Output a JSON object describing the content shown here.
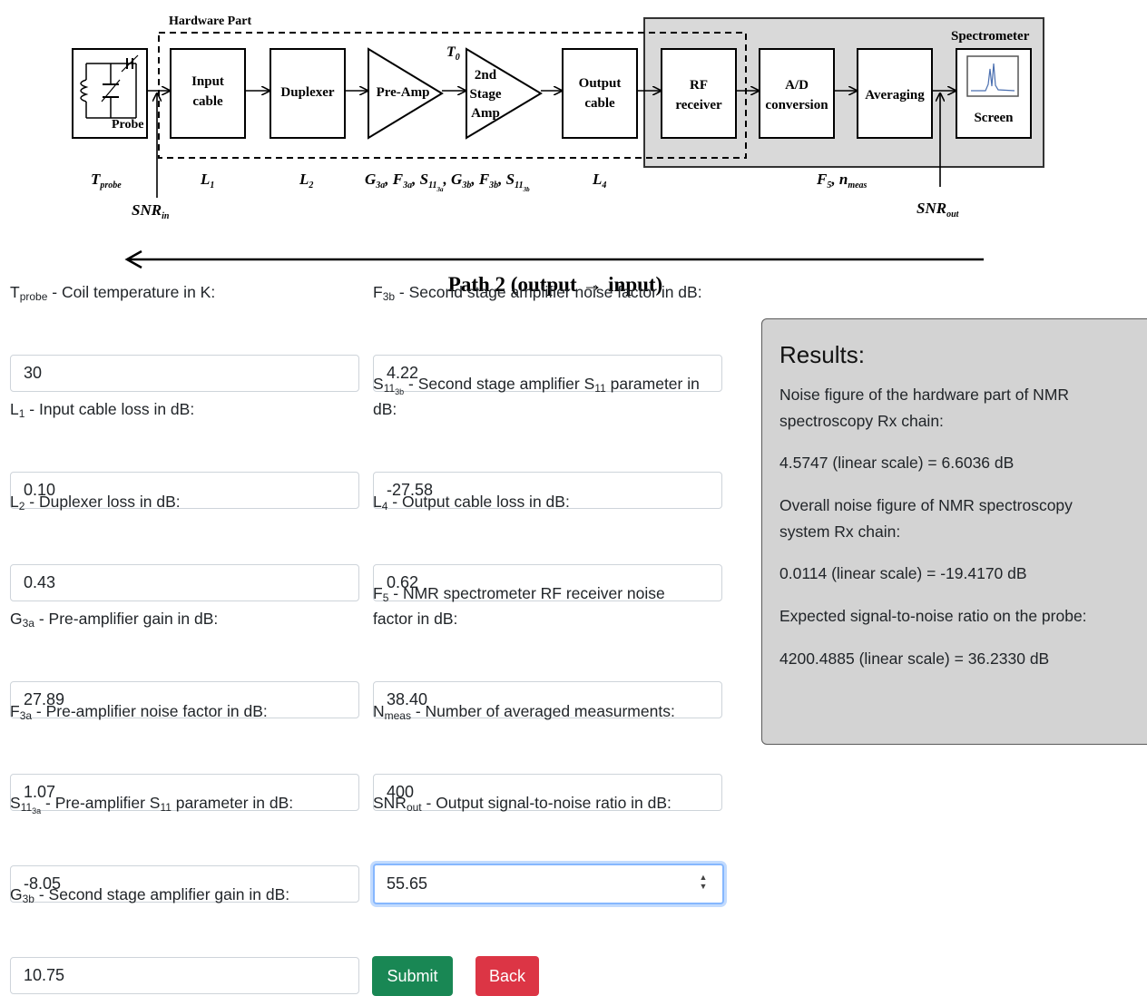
{
  "diagram": {
    "hardware_part": "Hardware Part",
    "spectrometer": "Spectrometer",
    "probe": "Probe",
    "blocks": {
      "input_cable": [
        "Input",
        "cable"
      ],
      "duplexer": "Duplexer",
      "pre_amp": "Pre-Amp",
      "stage2_amp": [
        "2nd",
        "Stage",
        "Amp"
      ],
      "output_cable": [
        "Output",
        "cable"
      ],
      "rf_receiver": [
        "RF",
        "receiver"
      ],
      "ad_conversion": [
        "A/D",
        "conversion"
      ],
      "averaging": "Averaging",
      "screen": "Screen"
    },
    "t0": "T",
    "t0_sub": "0",
    "labels": {
      "tprobe": "T",
      "tprobe_sub": "probe",
      "snr_in": "SNR",
      "snr_in_sub": "in",
      "l1": "L",
      "l1_sub": "1",
      "l2": "L",
      "l2_sub": "2",
      "g3a": "G",
      "g3a_sub": "3a",
      "f3a": "F",
      "f3a_sub": "3a",
      "s11_3a": "S",
      "s11_3a_sub": "11",
      "s11_3a_subsub": "3a",
      "g3b": "G",
      "g3b_sub": "3b",
      "f3b": "F",
      "f3b_sub": "3b",
      "s11_3b": "S",
      "s11_3b_sub": "11",
      "s11_3b_subsub": "3b",
      "l4": "L",
      "l4_sub": "4",
      "f5": "F",
      "f5_sub": "5",
      "nmeas": "n",
      "nmeas_sub": "meas",
      "snr_out": "SNR",
      "snr_out_sub": "out",
      "comma": ","
    },
    "path_label": "Path 2 (output → input)"
  },
  "form": {
    "tprobe": {
      "sym": "T",
      "sub": "probe",
      "desc": " - Coil temperature in K:",
      "value": "30"
    },
    "l1": {
      "sym": "L",
      "sub": "1",
      "desc": " - Input cable loss in dB:",
      "value": "0.10"
    },
    "l2": {
      "sym": "L",
      "sub": "2",
      "desc": " - Duplexer loss in dB:",
      "value": "0.43"
    },
    "g3a": {
      "sym": "G",
      "sub": "3a",
      "desc": " - Pre-amplifier gain in dB:",
      "value": "27.89"
    },
    "f3a": {
      "sym": "F",
      "sub": "3a",
      "desc": " - Pre-amplifier noise factor in dB:",
      "value": "1.07"
    },
    "s11_3a": {
      "sym": "S",
      "sub": "11",
      "subsub": "3a",
      "desc": " - Pre-amplifier S",
      "desc_sub": "11",
      "desc_tail": " parameter in dB:",
      "value": "-8.05"
    },
    "g3b": {
      "sym": "G",
      "sub": "3b",
      "desc": " - Second stage amplifier gain in dB:",
      "value": "10.75"
    },
    "f3b": {
      "sym": "F",
      "sub": "3b",
      "desc": " - Second stage amplifier noise factor in dB:",
      "value": "4.22"
    },
    "s11_3b": {
      "sym": "S",
      "sub": "11",
      "subsub": "3b",
      "desc": " - Second stage amplifier S",
      "desc_sub": "11",
      "desc_tail": " parameter in dB:",
      "value": "-27.58"
    },
    "l4": {
      "sym": "L",
      "sub": "4",
      "desc": " - Output cable loss in dB:",
      "value": "0.62"
    },
    "f5": {
      "sym": "F",
      "sub": "5",
      "desc": " - NMR spectrometer RF receiver noise factor in dB:",
      "value": "38.40"
    },
    "nmeas": {
      "sym": "N",
      "sub": "meas",
      "desc": " - Number of averaged measurments:",
      "value": "400"
    },
    "snr_out": {
      "sym": "SNR",
      "sub": "out",
      "desc": " - Output signal-to-noise ratio in dB:",
      "value": "55.65"
    }
  },
  "buttons": {
    "submit": "Submit",
    "back": "Back"
  },
  "results": {
    "title": "Results:",
    "nf_hw_label": "Noise figure of the hardware part of NMR spectroscopy Rx chain:",
    "nf_hw_value": "4.5747 (linear scale) = 6.6036 dB",
    "nf_overall_label": "Overall noise figure of NMR spectroscopy system Rx chain:",
    "nf_overall_value": "0.0114 (linear scale) = -19.4170 dB",
    "snr_label": "Expected signal-to-noise ratio on the probe:",
    "snr_value": "4200.4885 (linear scale) = 36.2330 dB"
  },
  "colors": {
    "submit": "#198754",
    "back": "#dc3545",
    "results_bg": "#d3d3d3",
    "spectrometer_bg": "#d9d9d9"
  }
}
